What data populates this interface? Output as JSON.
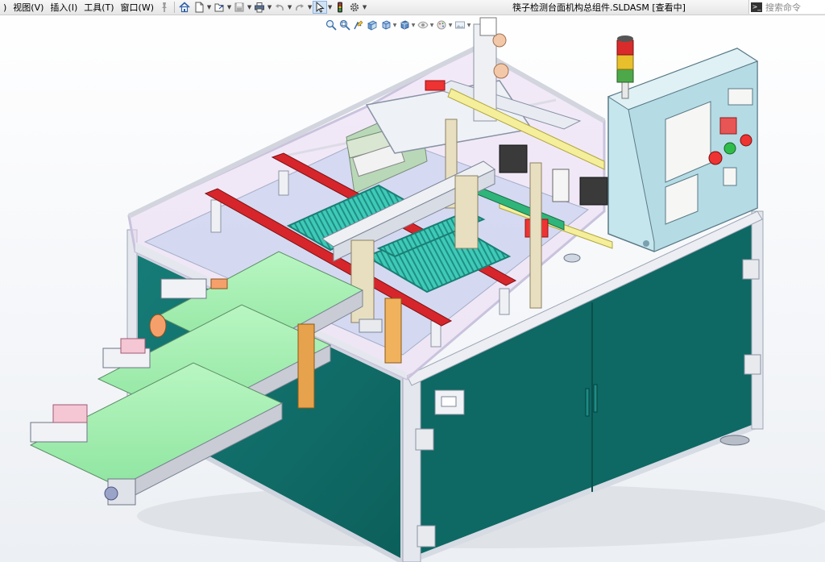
{
  "menu": {
    "items": [
      {
        "label": ")"
      },
      {
        "label": "视图(V)"
      },
      {
        "label": "插入(I)"
      },
      {
        "label": "工具(T)"
      },
      {
        "label": "窗口(W)"
      }
    ]
  },
  "toolbar": {
    "icons": [
      "pin-icon",
      "home-icon",
      "new-document-icon",
      "open-icon",
      "save-icon",
      "print-icon",
      "undo-icon",
      "redo-icon",
      "select-arrow-icon",
      "traffic-light-icon",
      "gear-icon"
    ]
  },
  "document": {
    "title": "筷子检测台面机构总组件.SLDASM [查看中]"
  },
  "search": {
    "placeholder": "搜索命令"
  },
  "hud": {
    "icons": [
      "zoom-to-fit-icon",
      "zoom-area-icon",
      "previous-view-icon",
      "section-view-icon",
      "view-orientation-icon",
      "display-style-icon",
      "hide-show-icon",
      "appearance-icon",
      "scene-icon"
    ]
  },
  "colors": {
    "frame": "#d9dce6",
    "panel_teal": "#106e6a",
    "belt_green": "#a6f0b0",
    "red_rail": "#d6262b",
    "tray_cyan": "#3ecab8",
    "cabinet": "#c6e6ee",
    "glass": "#e8d8f0"
  }
}
